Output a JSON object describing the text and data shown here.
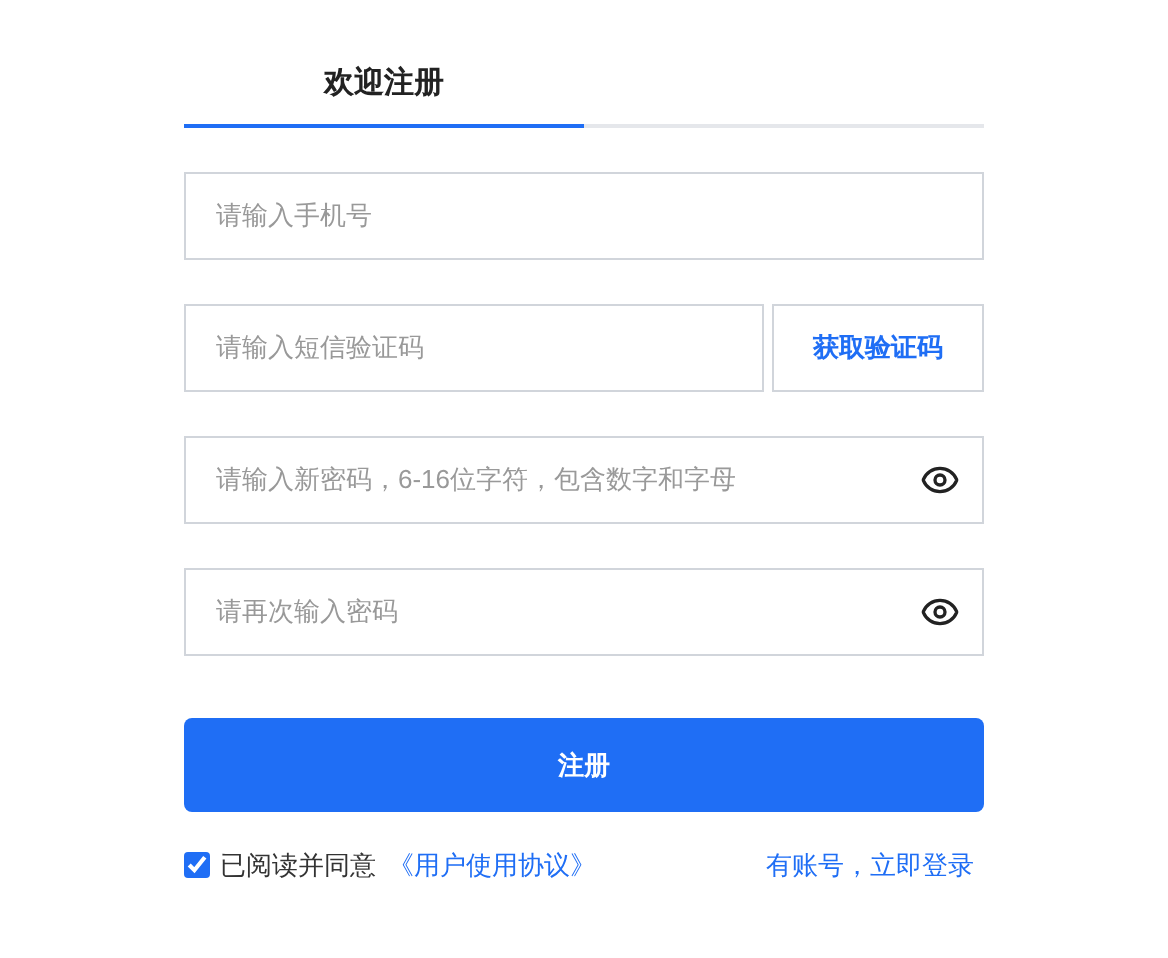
{
  "tabs": [
    {
      "label": "欢迎注册",
      "selected": true
    }
  ],
  "fields": [
    {
      "placeholder": "请输入手机号",
      "kind": "text"
    },
    {
      "placeholder": "请输入短信验证码",
      "kind": "code",
      "button": "获取验证码"
    },
    {
      "placeholder": "请输入新密码，6-16位字符，包含数字和字母",
      "kind": "password"
    },
    {
      "placeholder": "请再次输入密码",
      "kind": "password"
    }
  ],
  "submit": "注册",
  "agreement": {
    "checked": true,
    "text": "已阅读并同意",
    "link": "《用户使用协议》"
  },
  "login_link": "有账号，立即登录"
}
